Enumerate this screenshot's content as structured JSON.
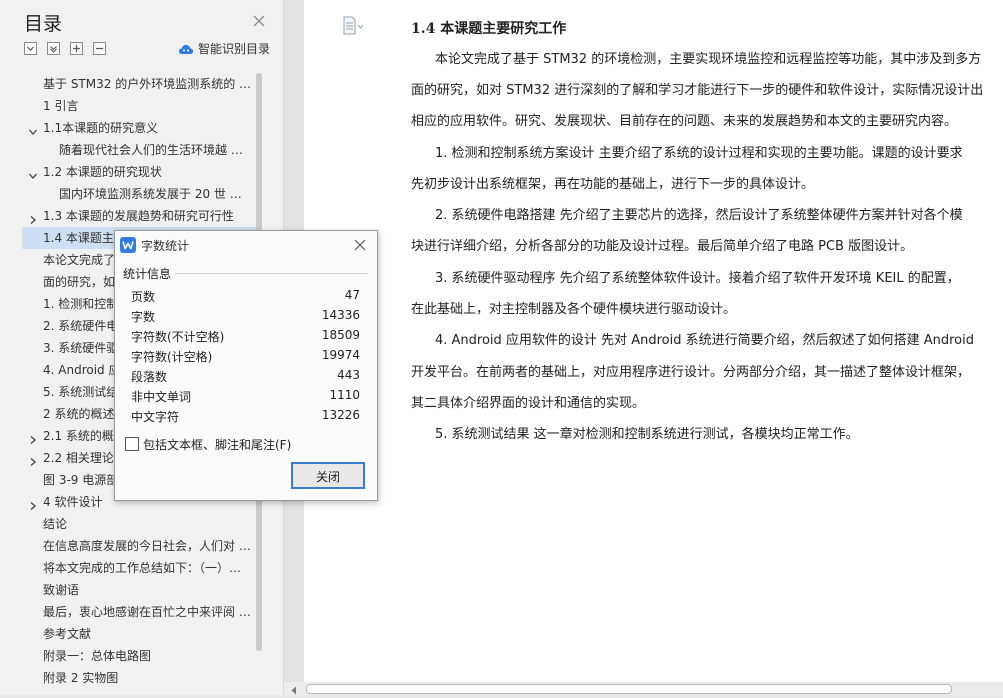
{
  "toc": {
    "title": "目录",
    "smart_label": "智能识别目录",
    "items": [
      {
        "label": "基于 STM32 的户外环境监测系统的 …",
        "indent": 1,
        "caret": ""
      },
      {
        "label": "1 引言",
        "indent": 1,
        "caret": ""
      },
      {
        "label": "1.1本课题的研究意义",
        "indent": 1,
        "caret": "down"
      },
      {
        "label": "随着现代社会人们的生活环境越 …",
        "indent": 2,
        "caret": ""
      },
      {
        "label": "1.2  本课题的研究现状",
        "indent": 1,
        "caret": "down"
      },
      {
        "label": "国内环境监测系统发展于 20 世 …",
        "indent": 2,
        "caret": ""
      },
      {
        "label": "1.3 本课题的发展趋势和研究可行性",
        "indent": 1,
        "caret": "right"
      },
      {
        "label": "1.4 本课题主要研究工作",
        "indent": 1,
        "caret": "",
        "selected": true
      },
      {
        "label": "本论文完成了基于 STM32 的环境检测",
        "indent": 1,
        "caret": ""
      },
      {
        "label": "面的研究，如对 STM32 进行深刻的了解",
        "indent": 1,
        "caret": ""
      },
      {
        "label": "1. 检测和控制系统方案设计",
        "indent": 1,
        "caret": ""
      },
      {
        "label": "2. 系统硬件电路搭建",
        "indent": 1,
        "caret": ""
      },
      {
        "label": "3. 系统硬件驱动程序",
        "indent": 1,
        "caret": ""
      },
      {
        "label": "4. Android 应用软件的设计",
        "indent": 1,
        "caret": ""
      },
      {
        "label": "5. 系统测试结果",
        "indent": 1,
        "caret": ""
      },
      {
        "label": "2 系统的概述",
        "indent": 1,
        "caret": ""
      },
      {
        "label": "2.1  系统的概述",
        "indent": 1,
        "caret": "right"
      },
      {
        "label": "2.2  相关理论",
        "indent": 1,
        "caret": "right"
      },
      {
        "label": "图 3-9 电源部分",
        "indent": 1,
        "caret": ""
      },
      {
        "label": "4  软件设计",
        "indent": 1,
        "caret": "right"
      },
      {
        "label": "结论",
        "indent": 1,
        "caret": ""
      },
      {
        "label": "在信息高度发展的今日社会，人们对 …",
        "indent": 1,
        "caret": ""
      },
      {
        "label": "将本文完成的工作总结如下：（一）…",
        "indent": 1,
        "caret": ""
      },
      {
        "label": "致谢语",
        "indent": 1,
        "caret": ""
      },
      {
        "label": "最后，衷心地感谢在百忙之中来评阅 …",
        "indent": 1,
        "caret": ""
      },
      {
        "label": "参考文献",
        "indent": 1,
        "caret": ""
      },
      {
        "label": "附录一：总体电路图",
        "indent": 1,
        "caret": ""
      },
      {
        "label": "附录 2  实物图",
        "indent": 1,
        "caret": ""
      }
    ]
  },
  "document": {
    "heading": "1.4 本课题主要研究工作",
    "lines": [
      "本论文完成了基于 STM32 的环境检测，主要实现环境监控和远程监控等功能，其中涉及到多方",
      "面的研究，如对 STM32 进行深刻的了解和学习才能进行下一步的硬件和软件设计，实际情况设计出",
      "相应的应用软件。研究、发展现状、目前存在的问题、未来的发展趋势和本文的主要研究内容。",
      "1. 检测和控制系统方案设计  主要介绍了系统的设计过程和实现的主要功能。课题的设计要求",
      "先初步设计出系统框架，再在功能的基础上，进行下一步的具体设计。",
      "2. 系统硬件电路搭建  先介绍了主要芯片的选择，然后设计了系统整体硬件方案并针对各个模",
      "块进行详细介绍，分析各部分的功能及设计过程。最后简单介绍了电路 PCB 版图设计。",
      "3. 系统硬件驱动程序  先介绍了系统整体软件设计。接着介绍了软件开发环境 KEIL 的配置，",
      "在此基础上，对主控制器及各个硬件模块进行驱动设计。",
      "4. Android 应用软件的设计  先对 Android 系统进行简要介绍，然后叙述了如何搭建 Android",
      "开发平台。在前两者的基础上，对应用程序进行设计。分两部分介绍，其一描述了整体设计框架，",
      "其二具体介绍界面的设计和通信的实现。",
      "5. 系统测试结果  这一章对检测和控制系统进行测试，各模块均正常工作。"
    ]
  },
  "dialog": {
    "title": "字数统计",
    "section": "统计信息",
    "stats": [
      {
        "label": "页数",
        "value": "47"
      },
      {
        "label": "字数",
        "value": "14336"
      },
      {
        "label": "字符数(不计空格)",
        "value": "18509"
      },
      {
        "label": "字符数(计空格)",
        "value": "19974"
      },
      {
        "label": "段落数",
        "value": "443"
      },
      {
        "label": "非中文单词",
        "value": "1110"
      },
      {
        "label": "中文字符",
        "value": "13226"
      }
    ],
    "checkbox_label": "包括文本框、脚注和尾注(F)",
    "checkbox_checked": false,
    "close_label": "关闭"
  },
  "colors": {
    "selection": "#cfdff3",
    "accent": "#3b7bd4",
    "wps_logo": "#2f7de1"
  }
}
